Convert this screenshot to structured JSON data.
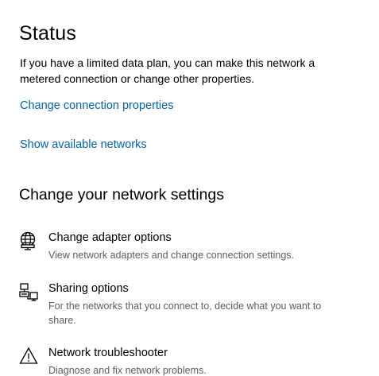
{
  "status": {
    "title": "Status",
    "description": "If you have a limited data plan, you can make this network a metered connection or change other properties.",
    "change_connection_link": "Change connection properties",
    "show_networks_link": "Show available networks"
  },
  "network_settings": {
    "title": "Change your network settings",
    "options": [
      {
        "icon": "globe-adapter-icon",
        "title": "Change adapter options",
        "subtitle": "View network adapters and change connection settings."
      },
      {
        "icon": "sharing-icon",
        "title": "Sharing options",
        "subtitle": "For the networks that you connect to, decide what you want to share."
      },
      {
        "icon": "warning-icon",
        "title": "Network troubleshooter",
        "subtitle": "Diagnose and fix network problems."
      }
    ]
  },
  "colors": {
    "link": "#0063b1",
    "subtext": "#5d5d5d",
    "background": "#ffffff"
  }
}
